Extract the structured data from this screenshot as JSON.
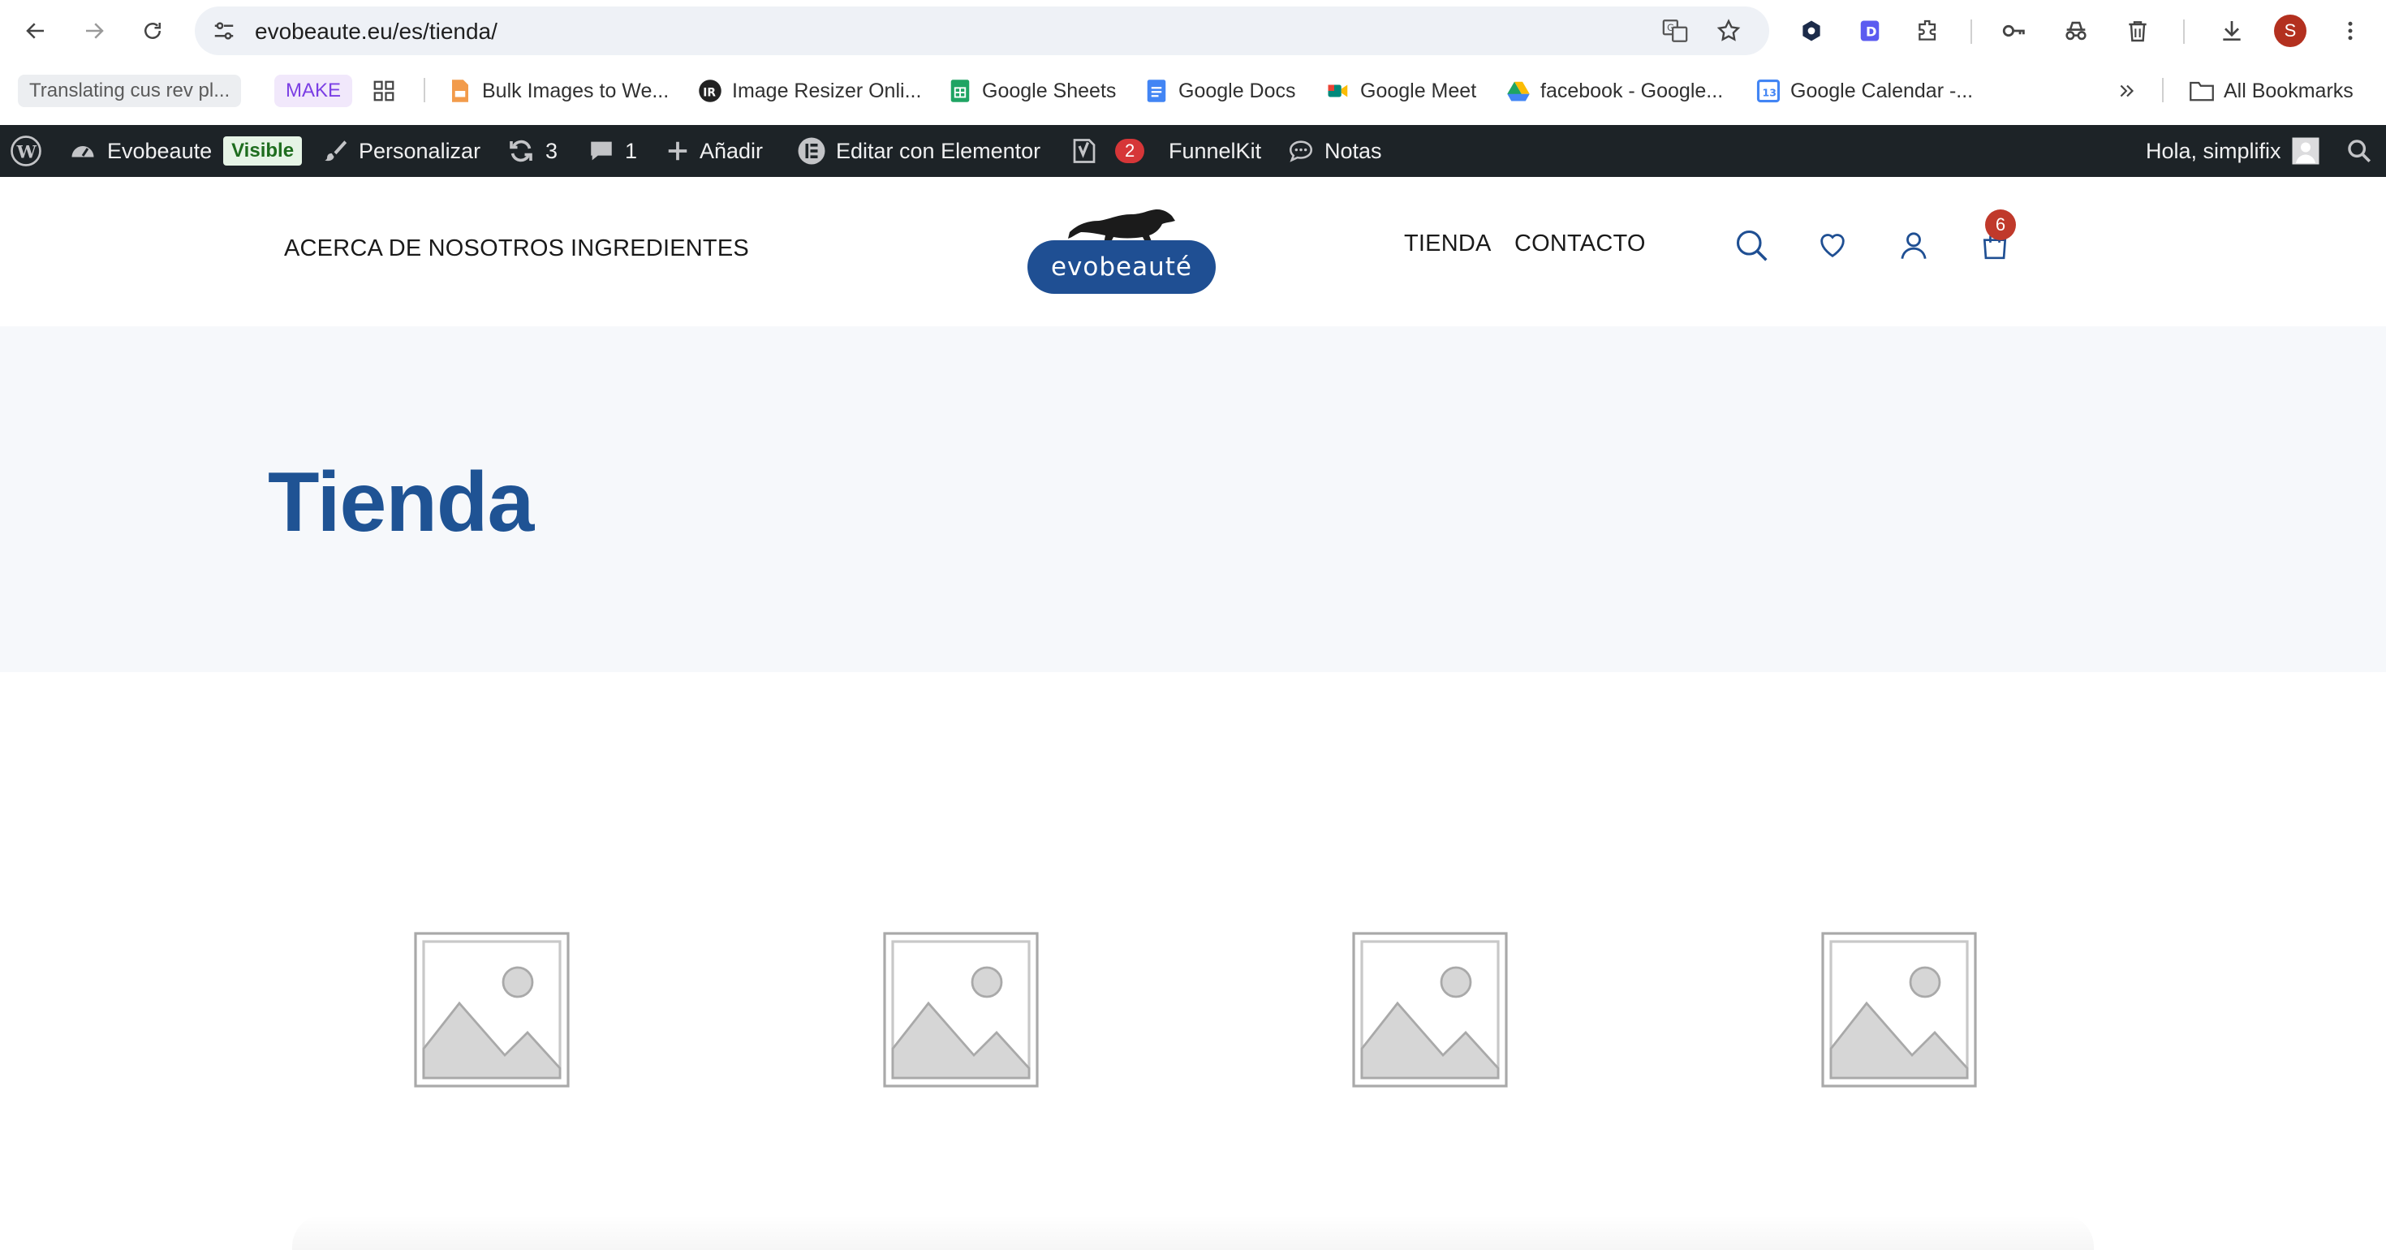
{
  "browser": {
    "url": "evobeaute.eu/es/tienda/",
    "profile_initial": "S",
    "bookmarks": [
      {
        "label": "Translating cus rev pl..."
      },
      {
        "label": "MAKE"
      },
      {
        "label": "Bulk Images to We..."
      },
      {
        "label": "Image Resizer Onli..."
      },
      {
        "label": "Google Sheets"
      },
      {
        "label": "Google Docs"
      },
      {
        "label": "Google Meet"
      },
      {
        "label": "facebook - Google..."
      },
      {
        "label": "Google Calendar -..."
      }
    ],
    "all_bookmarks": "All Bookmarks"
  },
  "wp_admin_bar": {
    "site_name": "Evobeaute",
    "visibility_badge": "Visible",
    "customize": "Personalizar",
    "updates_count": "3",
    "comments_count": "1",
    "add_new": "Añadir",
    "elementor": "Editar con Elementor",
    "yoast_count": "2",
    "funnelkit": "FunnelKit",
    "notes": "Notas",
    "greeting": "Hola, simplifix"
  },
  "site_header": {
    "menu_left": [
      "ACERCA DE NOSOTROS",
      "INGREDIENTES"
    ],
    "logo_text": "evobeauté",
    "menu_right": [
      "TIENDA",
      "CONTACTO"
    ],
    "cart_count": "6",
    "icons": [
      "search-icon",
      "heart-icon",
      "user-icon",
      "cart-icon"
    ]
  },
  "page": {
    "title": "Tienda"
  },
  "products": [
    {
      "image": "placeholder"
    },
    {
      "image": "placeholder"
    },
    {
      "image": "placeholder"
    },
    {
      "image": "placeholder"
    }
  ],
  "colors": {
    "brand_blue": "#1f4f93",
    "title_blue": "#1f5394",
    "admin_bar": "#1d2327",
    "badge_red": "#c0392b"
  }
}
